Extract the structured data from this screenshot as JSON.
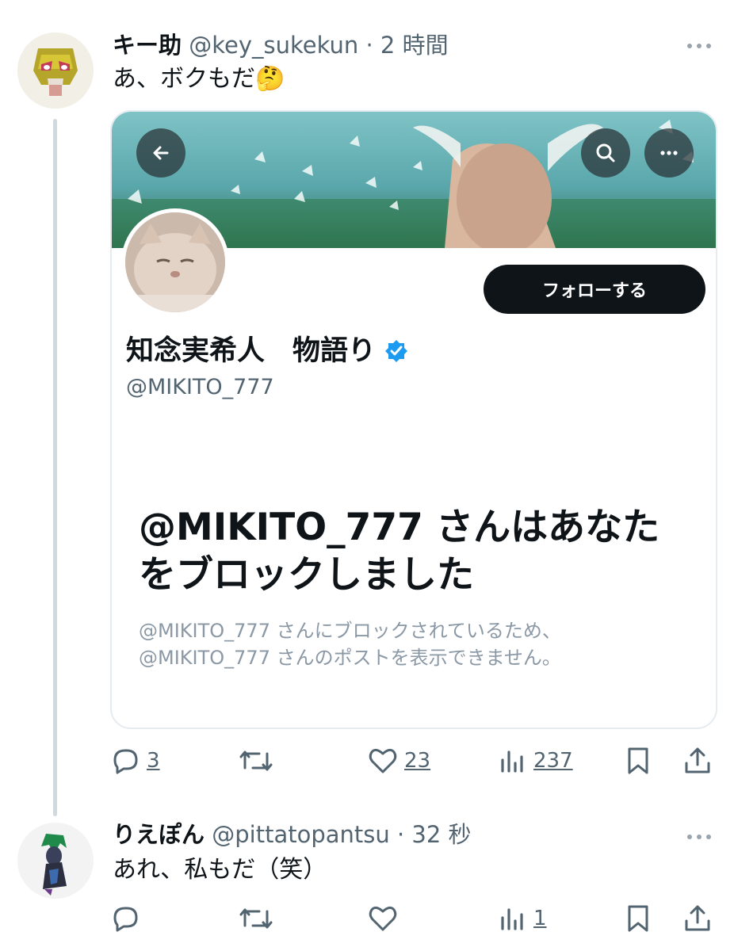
{
  "posts": [
    {
      "name": "キー助",
      "handle": "@key_sukekun",
      "separator": "·",
      "time": "2 時間",
      "text": "あ、ボクもだ",
      "emoji": "🤔",
      "embed": {
        "follow_label": "フォローする",
        "display_name": "知念実希人　物語り",
        "handle": "@MIKITO_777",
        "blocked_title": "@MIKITO_777 さんはあなたをブロックしました",
        "blocked_desc_1": "@MIKITO_777 さんにブロックされているため、",
        "blocked_desc_2": "@MIKITO_777 さんのポストを表示できません。"
      },
      "stats": {
        "replies": "3",
        "reposts": "",
        "likes": "23",
        "views": "237"
      }
    },
    {
      "name": "りえぽん",
      "handle": "@pittatopantsu",
      "separator": "·",
      "time": "32 秒",
      "text": "あれ、私もだ（笑）",
      "stats": {
        "replies": "",
        "reposts": "",
        "likes": "",
        "views": "1"
      }
    }
  ],
  "colors": {
    "text": "#0f1419",
    "secondary": "#536471",
    "verified": "#1d9bf0",
    "thread_line": "#cfd9de"
  }
}
